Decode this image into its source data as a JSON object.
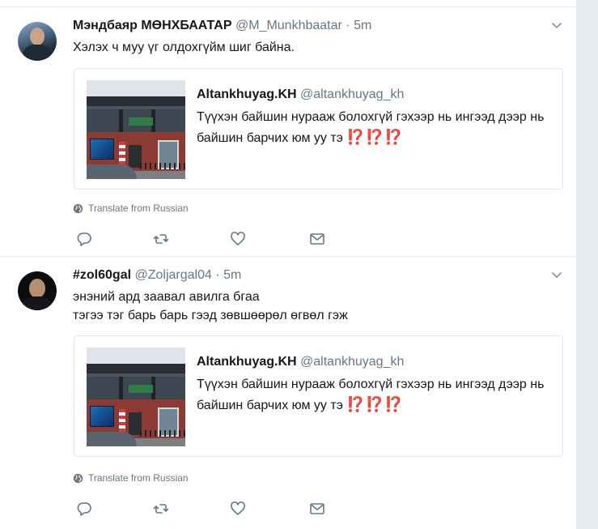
{
  "tweets": [
    {
      "fullname": "Мэндбаяр МӨНХБААТАР",
      "handle": "@M_Munkhbaatar",
      "separator": "·",
      "time": "5m",
      "text_lines": [
        "Хэлэх ч муу үг олдохгүйм шиг байна."
      ],
      "avatar_icon": "user-avatar",
      "quote": {
        "fullname": "Altankhuyag.KH",
        "handle": "@altankhuyag_kh",
        "text": "Түүхэн байшин нурааж болохгүй гэхээр нь ингээд дээр нь байшин барчих юм уу тэ",
        "emoji": "⁉️⁉️⁉️"
      },
      "translate_label": "Translate from Russian"
    },
    {
      "fullname": "#zol60gal",
      "handle": "@Zoljargal04",
      "separator": "·",
      "time": "5m",
      "text_lines": [
        "энэний ард заавал авилга бгаа",
        "тэгээ тэг барь барь гээд зөвшөөрөл өгвөл гэж"
      ],
      "avatar_icon": "user-avatar",
      "quote": {
        "fullname": "Altankhuyag.KH",
        "handle": "@altankhuyag_kh",
        "text": "Түүхэн байшин нурааж болохгүй гэхээр нь ингээд дээр нь байшин барчих юм уу тэ",
        "emoji": "⁉️⁉️⁉️"
      },
      "translate_label": "Translate from Russian"
    }
  ],
  "icons": {
    "reply": "reply-icon",
    "retweet": "retweet-icon",
    "like": "heart-icon",
    "dm": "envelope-icon",
    "globe": "globe-icon",
    "caret": "chevron-down-icon"
  },
  "colors": {
    "name": "#14171a",
    "secondary": "#657786",
    "divider": "#e6ecf0",
    "emoji_red": "#be1931"
  }
}
